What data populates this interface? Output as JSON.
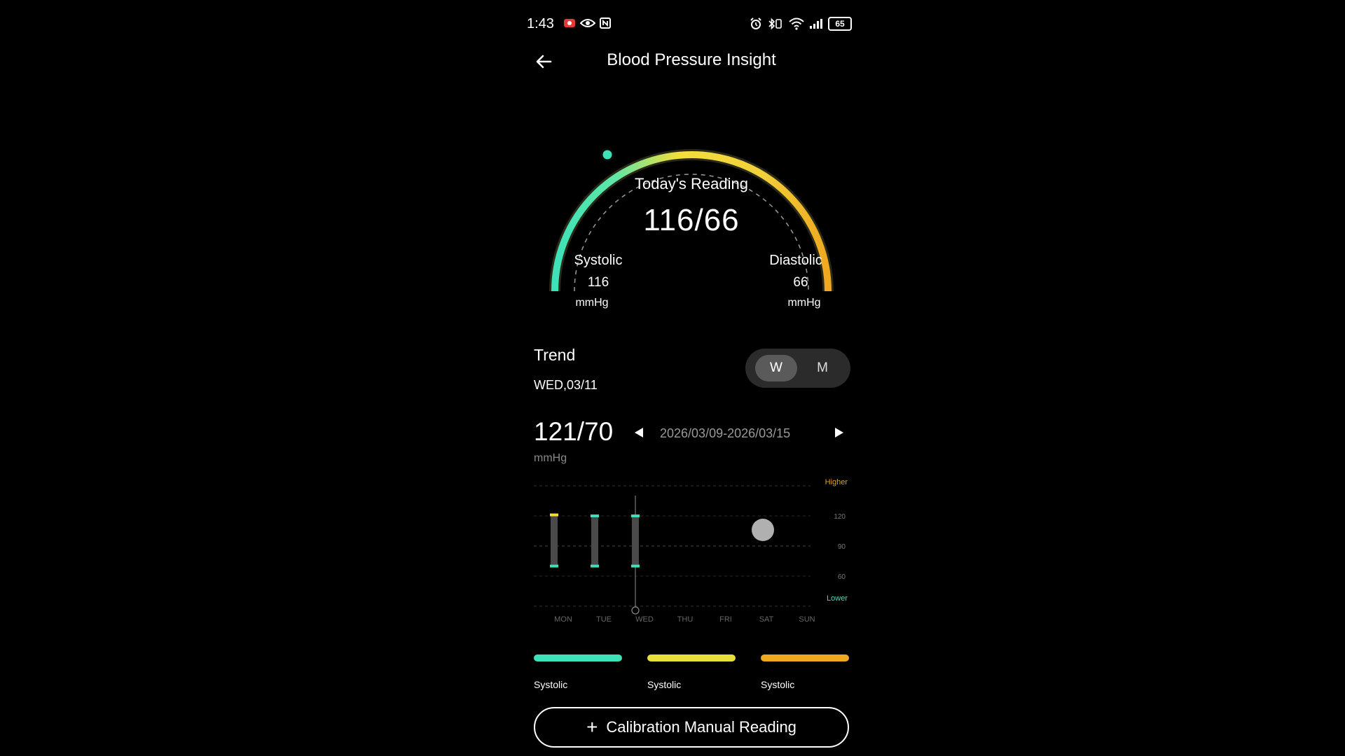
{
  "status_bar": {
    "time": "1:43",
    "battery": "65",
    "left_icons": [
      "screen-record-icon",
      "eye-icon",
      "nfc-icon"
    ],
    "right_icons": [
      "alarm-icon",
      "bluetooth-vibrate-icon",
      "wifi-icon",
      "signal-icon",
      "battery-icon"
    ]
  },
  "header": {
    "title": "Blood Pressure Insight"
  },
  "gauge": {
    "label": "Today's Reading",
    "value": "116/66",
    "systolic": {
      "title": "Systolic",
      "value": "116",
      "unit": "mmHg"
    },
    "diastolic": {
      "title": "Diastolic",
      "value": "66",
      "unit": "mmHg"
    },
    "colors": {
      "low": "#3ee2b8",
      "mid": "#f2df3c",
      "high": "#f0a821"
    }
  },
  "trend": {
    "title": "Trend",
    "date": "WED,03/11",
    "toggle": {
      "week": "W",
      "month": "M",
      "selected": "W"
    },
    "current_value": "121/70",
    "unit": "mmHg",
    "date_range": "2026/03/09-2026/03/15"
  },
  "chart_data": {
    "type": "range-bar",
    "categories": [
      "MON",
      "TUE",
      "WED",
      "THU",
      "FRI",
      "SAT",
      "SUN"
    ],
    "y_ticks": [
      120,
      90,
      60
    ],
    "zone_labels": {
      "higher": "Higher",
      "lower": "Lower"
    },
    "ylim": [
      30,
      150
    ],
    "series": [
      {
        "x": "MON",
        "systolic": 121,
        "diastolic": 70,
        "systolic_color": "#f2df3c",
        "diastolic_color": "#3ee2b8"
      },
      {
        "x": "TUE",
        "systolic": 120,
        "diastolic": 70,
        "systolic_color": "#3ee2b8",
        "diastolic_color": "#3ee2b8"
      },
      {
        "x": "WED",
        "systolic": 120,
        "diastolic": 70,
        "systolic_color": "#3ee2b8",
        "diastolic_color": "#3ee2b8"
      }
    ],
    "selected": "WED",
    "grid": true
  },
  "legend": [
    {
      "label": "Systolic",
      "color": "#3ee2b8"
    },
    {
      "label": "Systolic",
      "color": "#e8e03a"
    },
    {
      "label": "Systolic",
      "color": "#f0a821"
    }
  ],
  "calibration_button": {
    "label": "Calibration Manual Reading"
  }
}
